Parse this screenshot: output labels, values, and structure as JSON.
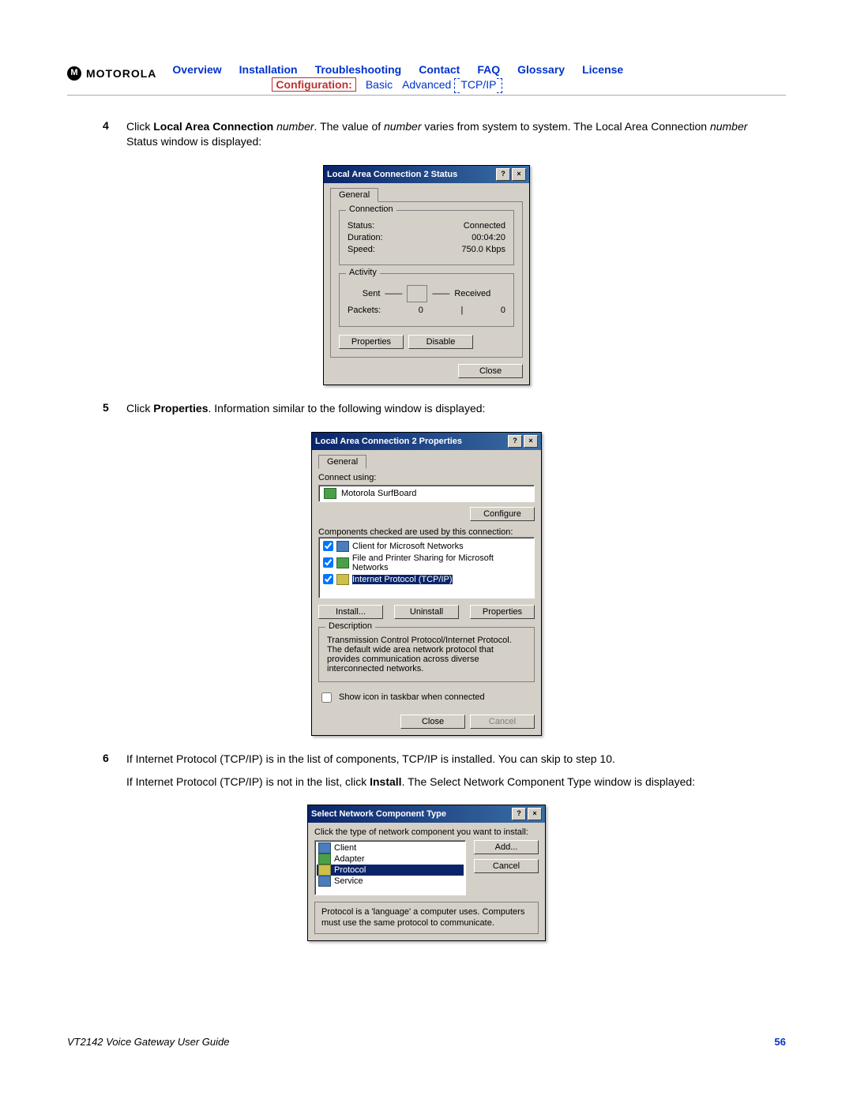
{
  "header": {
    "brand": "MOTOROLA",
    "nav": [
      "Overview",
      "Installation",
      "Troubleshooting",
      "Contact",
      "FAQ",
      "Glossary",
      "License"
    ],
    "subnav_label": "Configuration:",
    "subnav": [
      "Basic",
      "Advanced",
      "TCP/IP"
    ]
  },
  "steps": {
    "s4": {
      "num": "4",
      "t1a": "Click ",
      "t1b": "Local Area Connection",
      "t1c": " number",
      "t1d": ". The value of ",
      "t1e": "number",
      "t1f": " varies from system to system. The Local Area Connection ",
      "t1g": "number",
      "t1h": " Status window is displayed:"
    },
    "s5": {
      "num": "5",
      "t1a": "Click ",
      "t1b": "Properties",
      "t1c": ". Information similar to the following window is displayed:"
    },
    "s6": {
      "num": "6",
      "p1": "If Internet Protocol (TCP/IP) is in the list of components, TCP/IP is installed. You can skip to step 10.",
      "p2a": "If Internet Protocol (TCP/IP) is not in the list, click ",
      "p2b": "Install",
      "p2c": ". The Select Network Component Type window is displayed:"
    }
  },
  "status_window": {
    "title": "Local Area Connection 2 Status",
    "tab": "General",
    "group_conn": "Connection",
    "labels": {
      "status": "Status:",
      "duration": "Duration:",
      "speed": "Speed:"
    },
    "values": {
      "status": "Connected",
      "duration": "00:04:20",
      "speed": "750.0 Kbps"
    },
    "group_act": "Activity",
    "sent": "Sent",
    "received": "Received",
    "packets_label": "Packets:",
    "packets_sent": "0",
    "packets_recv": "0",
    "btn_properties": "Properties",
    "btn_disable": "Disable",
    "btn_close": "Close"
  },
  "props_window": {
    "title": "Local Area Connection 2 Properties",
    "tab": "General",
    "connect_using": "Connect using:",
    "adapter": "Motorola SurfBoard",
    "btn_configure": "Configure",
    "components_label": "Components checked are used by this connection:",
    "components": [
      "Client for Microsoft Networks",
      "File and Printer Sharing for Microsoft Networks",
      "Internet Protocol (TCP/IP)"
    ],
    "btn_install": "Install...",
    "btn_uninstall": "Uninstall",
    "btn_properties": "Properties",
    "group_desc": "Description",
    "desc": "Transmission Control Protocol/Internet Protocol. The default wide area network protocol that provides communication across diverse interconnected networks.",
    "show_icon": "Show icon in taskbar when connected",
    "btn_close": "Close",
    "btn_cancel": "Cancel"
  },
  "type_window": {
    "title": "Select Network Component Type",
    "prompt": "Click the type of network component you want to install:",
    "items": [
      "Client",
      "Adapter",
      "Protocol",
      "Service"
    ],
    "btn_add": "Add...",
    "btn_cancel": "Cancel",
    "desc": "Protocol is a 'language' a computer uses. Computers must use the same protocol to communicate."
  },
  "footer": {
    "title": "VT2142 Voice Gateway User Guide",
    "page": "56"
  }
}
